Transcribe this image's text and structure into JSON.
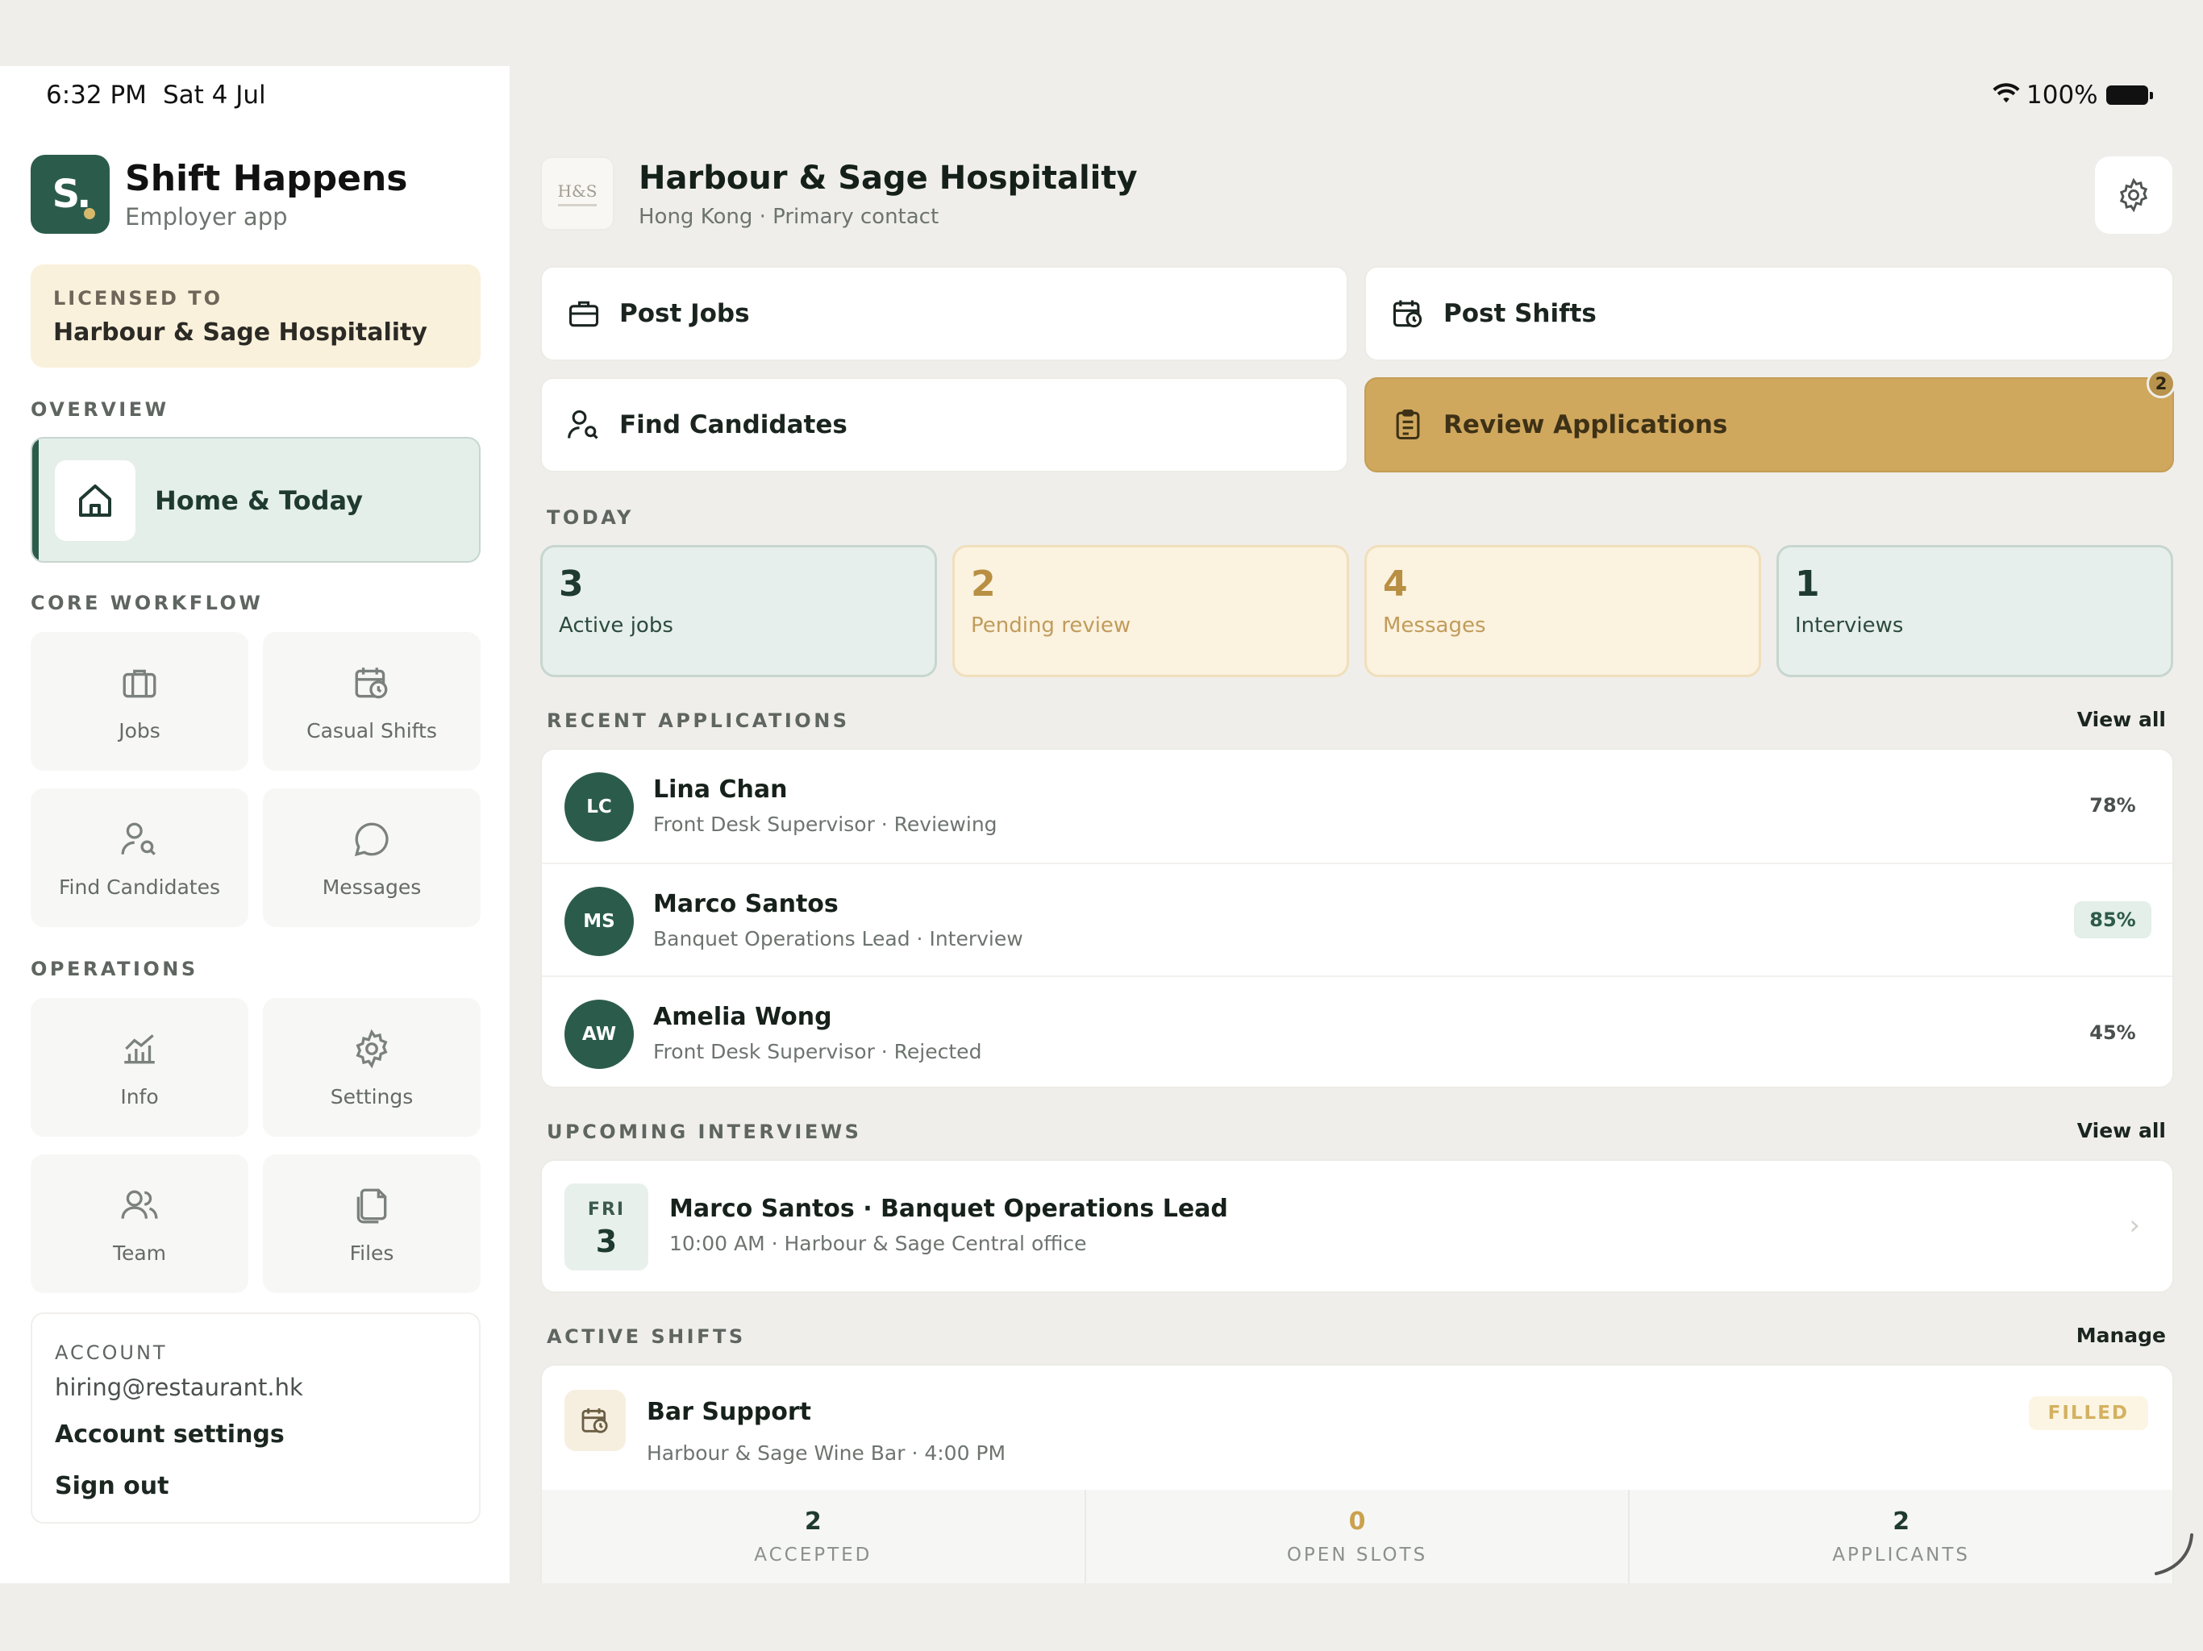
{
  "status_bar": {
    "time": "6:32 PM",
    "date": "Sat 4 Jul",
    "battery": "100%"
  },
  "brand": {
    "logo_letter": "S.",
    "name": "Shift Happens",
    "subtitle": "Employer app"
  },
  "license": {
    "kicker": "LICENSED TO",
    "name": "Harbour & Sage Hospitality"
  },
  "sidebar": {
    "overview_label": "OVERVIEW",
    "home_label": "Home & Today",
    "core_label": "CORE WORKFLOW",
    "core_items": [
      {
        "label": "Jobs",
        "icon": "briefcase-icon"
      },
      {
        "label": "Casual Shifts",
        "icon": "calendar-clock-icon"
      },
      {
        "label": "Find Candidates",
        "icon": "person-search-icon"
      },
      {
        "label": "Messages",
        "icon": "chat-bubble-icon"
      }
    ],
    "operations_label": "OPERATIONS",
    "operations_items": [
      {
        "label": "Info",
        "icon": "chart-icon"
      },
      {
        "label": "Settings",
        "icon": "gear-icon"
      },
      {
        "label": "Team",
        "icon": "people-icon"
      },
      {
        "label": "Files",
        "icon": "files-icon"
      }
    ]
  },
  "account": {
    "kicker": "ACCOUNT",
    "email": "hiring@restaurant.hk",
    "settings_label": "Account settings",
    "signout_label": "Sign out"
  },
  "header": {
    "org_logo_text": "H&S",
    "org_name": "Harbour & Sage Hospitality",
    "org_sub": "Hong Kong · Primary contact"
  },
  "actions": {
    "post_jobs": "Post Jobs",
    "post_shifts": "Post Shifts",
    "find_candidates": "Find Candidates",
    "review_applications": "Review Applications",
    "review_badge": "2"
  },
  "today": {
    "label": "TODAY",
    "stats": [
      {
        "value": "3",
        "label": "Active jobs"
      },
      {
        "value": "2",
        "label": "Pending review"
      },
      {
        "value": "4",
        "label": "Messages"
      },
      {
        "value": "1",
        "label": "Interviews"
      }
    ]
  },
  "recent_applications": {
    "label": "RECENT APPLICATIONS",
    "view_all": "View all",
    "items": [
      {
        "initials": "LC",
        "name": "Lina Chan",
        "meta": "Front Desk Supervisor · Reviewing",
        "score": "78%"
      },
      {
        "initials": "MS",
        "name": "Marco Santos",
        "meta": "Banquet Operations Lead · Interview",
        "score": "85%"
      },
      {
        "initials": "AW",
        "name": "Amelia Wong",
        "meta": "Front Desk Supervisor · Rejected",
        "score": "45%"
      }
    ]
  },
  "upcoming_interviews": {
    "label": "UPCOMING INTERVIEWS",
    "view_all": "View all",
    "item": {
      "dow": "FRI",
      "day": "3",
      "title": "Marco Santos · Banquet Operations Lead",
      "meta": "10:00 AM · Harbour & Sage Central office"
    }
  },
  "active_shifts": {
    "label": "ACTIVE SHIFTS",
    "manage": "Manage",
    "item": {
      "title": "Bar Support",
      "meta": "Harbour & Sage Wine Bar · 4:00 PM",
      "status": "FILLED"
    },
    "stats": [
      {
        "value": "2",
        "label": "ACCEPTED"
      },
      {
        "value": "0",
        "label": "OPEN SLOTS"
      },
      {
        "value": "2",
        "label": "APPLICANTS"
      }
    ]
  },
  "colors": {
    "brand_green": "#2b5c4b",
    "gold": "#cfa85e",
    "background": "#efeeea"
  }
}
